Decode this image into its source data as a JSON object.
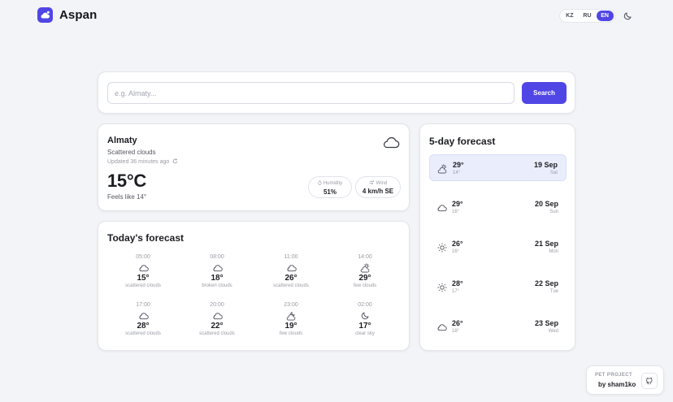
{
  "header": {
    "app_name": "Aspan",
    "languages": [
      "KZ",
      "RU",
      "EN"
    ],
    "active_language": "EN",
    "theme_icon": "moon-icon"
  },
  "search": {
    "placeholder": "e.g. Almaty...",
    "value": "",
    "button_label": "Search"
  },
  "current": {
    "city": "Almaty",
    "description": "Scattered clouds",
    "updated": "Updated 36 minutes ago",
    "temperature": "15°C",
    "feels_like": "Feels like 14°",
    "icon": "cloud-icon",
    "humidity_label": "Humidity",
    "humidity_value": "51%",
    "wind_label": "Wind",
    "wind_value": "4 km/h SE"
  },
  "today": {
    "title": "Today's forecast",
    "hours": [
      {
        "time": "05:00",
        "temp": "15°",
        "desc": "scattered clouds",
        "icon": "cloud-icon"
      },
      {
        "time": "08:00",
        "temp": "18°",
        "desc": "broken clouds",
        "icon": "cloud-icon"
      },
      {
        "time": "11:00",
        "temp": "26°",
        "desc": "scattered clouds",
        "icon": "cloud-icon"
      },
      {
        "time": "14:00",
        "temp": "29°",
        "desc": "few clouds",
        "icon": "sun-cloud-icon"
      },
      {
        "time": "17:00",
        "temp": "28°",
        "desc": "scattered clouds",
        "icon": "cloud-icon"
      },
      {
        "time": "20:00",
        "temp": "22°",
        "desc": "scattered clouds",
        "icon": "cloud-icon"
      },
      {
        "time": "23:00",
        "temp": "19°",
        "desc": "few clouds",
        "icon": "moon-cloud-icon"
      },
      {
        "time": "02:00",
        "temp": "17°",
        "desc": "clear sky",
        "icon": "moon-icon"
      }
    ]
  },
  "five_day": {
    "title": "5-day forecast",
    "days": [
      {
        "hi": "29°",
        "lo": "14°",
        "date": "19 Sep",
        "weekday": "Sat",
        "icon": "sun-cloud-icon",
        "selected": true
      },
      {
        "hi": "29°",
        "lo": "16°",
        "date": "20 Sep",
        "weekday": "Sun",
        "icon": "cloud-icon",
        "selected": false
      },
      {
        "hi": "26°",
        "lo": "16°",
        "date": "21 Sep",
        "weekday": "Mon",
        "icon": "sun-icon",
        "selected": false
      },
      {
        "hi": "28°",
        "lo": "17°",
        "date": "22 Sep",
        "weekday": "Tue",
        "icon": "sun-icon",
        "selected": false
      },
      {
        "hi": "26°",
        "lo": "18°",
        "date": "23 Sep",
        "weekday": "Wed",
        "icon": "cloud-icon",
        "selected": false
      }
    ]
  },
  "footer": {
    "label": "PET PROJECT",
    "author": "by sham1ko",
    "icon": "github-icon"
  },
  "colors": {
    "accent": "#5046e5",
    "background": "#f3f4f7",
    "selected_row": "#eaeefc"
  }
}
